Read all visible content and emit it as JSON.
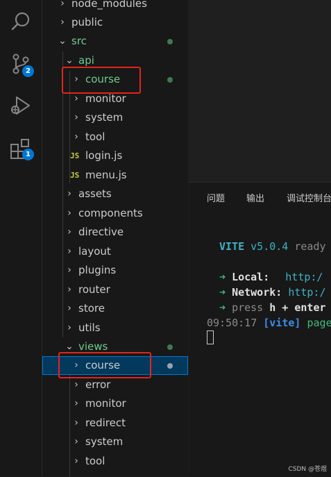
{
  "activity_bar": {
    "items": [
      {
        "name": "search",
        "badge": ""
      },
      {
        "name": "source-control",
        "badge": "2"
      },
      {
        "name": "run-and-debug",
        "badge": ""
      },
      {
        "name": "extensions",
        "badge": "1"
      }
    ]
  },
  "explorer": {
    "rows": [
      {
        "label": "node_modules",
        "type": "folder",
        "state": "collapsed"
      },
      {
        "label": "public",
        "type": "folder",
        "state": "collapsed"
      },
      {
        "label": "src",
        "type": "folder",
        "state": "expanded",
        "modified": true
      },
      {
        "label": "api",
        "type": "folder",
        "state": "expanded",
        "modified": true
      },
      {
        "label": "course",
        "type": "folder",
        "state": "collapsed",
        "modified": true,
        "highlighted": true
      },
      {
        "label": "monitor",
        "type": "folder",
        "state": "collapsed"
      },
      {
        "label": "system",
        "type": "folder",
        "state": "collapsed"
      },
      {
        "label": "tool",
        "type": "folder",
        "state": "collapsed"
      },
      {
        "label": "login.js",
        "type": "file",
        "icon": "JS"
      },
      {
        "label": "menu.js",
        "type": "file",
        "icon": "JS"
      },
      {
        "label": "assets",
        "type": "folder",
        "state": "collapsed"
      },
      {
        "label": "components",
        "type": "folder",
        "state": "collapsed"
      },
      {
        "label": "directive",
        "type": "folder",
        "state": "collapsed"
      },
      {
        "label": "layout",
        "type": "folder",
        "state": "collapsed"
      },
      {
        "label": "plugins",
        "type": "folder",
        "state": "collapsed"
      },
      {
        "label": "router",
        "type": "folder",
        "state": "collapsed"
      },
      {
        "label": "store",
        "type": "folder",
        "state": "collapsed"
      },
      {
        "label": "utils",
        "type": "folder",
        "state": "collapsed"
      },
      {
        "label": "views",
        "type": "folder",
        "state": "expanded",
        "modified": true
      },
      {
        "label": "course",
        "type": "folder",
        "state": "collapsed",
        "selected": true,
        "highlighted": true
      },
      {
        "label": "error",
        "type": "folder",
        "state": "collapsed"
      },
      {
        "label": "monitor",
        "type": "folder",
        "state": "collapsed"
      },
      {
        "label": "redirect",
        "type": "folder",
        "state": "collapsed"
      },
      {
        "label": "system",
        "type": "folder",
        "state": "collapsed"
      },
      {
        "label": "tool",
        "type": "folder",
        "state": "collapsed"
      }
    ]
  },
  "panel": {
    "tabs": [
      "问题",
      "输出",
      "调试控制台"
    ]
  },
  "terminal": {
    "vite_name": "VITE",
    "vite_version": "v5.0.4",
    "ready_text": "ready",
    "local_arrow": "➜",
    "local_label": "Local:",
    "local_url": "http:/",
    "network_arrow": "➜",
    "network_label": "Network:",
    "network_url": "http:/",
    "help_arrow": "➜",
    "help_text_1": "press",
    "help_key": "h + enter",
    "time": "09:50:17",
    "tag": "[vite]",
    "msg": "page"
  },
  "watermark": "CSDN @苍煜",
  "colors": {
    "accent": "#0078d4",
    "modified_green": "#73c991",
    "highlight_red": "#e3241c",
    "vite_cyan": "#3fb2c4"
  }
}
